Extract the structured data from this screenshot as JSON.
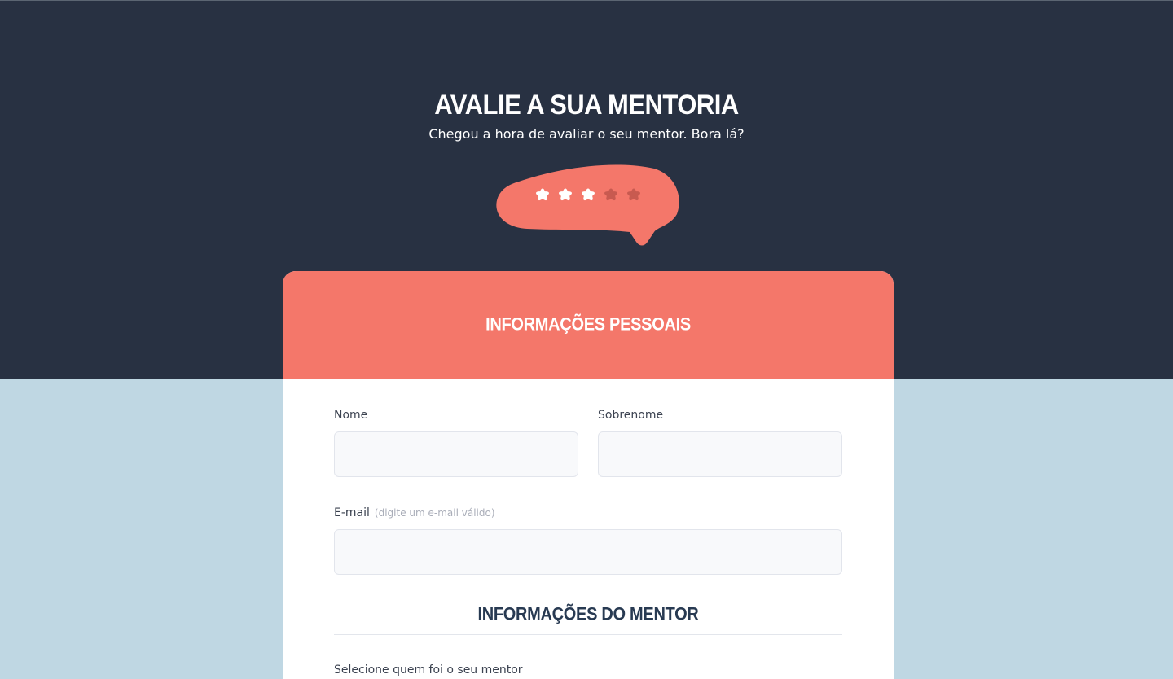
{
  "hero": {
    "title": "Avalie a sua mentoria",
    "subtitle": "Chegou a hora de avaliar o seu mentor. Bora lá?",
    "background_color": "#283142"
  },
  "rating": {
    "value": 3,
    "max": 5,
    "bubble_color": "#f4776a",
    "filled_star_color": "#ffffff",
    "empty_star_color": "#c85a50"
  },
  "personal_info": {
    "title": "Informações pessoais",
    "header_color": "#f4776a",
    "first_name": {
      "label": "Nome",
      "value": "",
      "placeholder": ""
    },
    "last_name": {
      "label": "Sobrenome",
      "value": "",
      "placeholder": ""
    },
    "email": {
      "label": "E-mail",
      "hint": "(digite um e-mail válido)",
      "value": "",
      "placeholder": ""
    }
  },
  "mentor_info": {
    "title": "Informações do mentor",
    "select_label": "Selecione quem foi o seu mentor"
  },
  "page_background_color": "#bfd7e3"
}
